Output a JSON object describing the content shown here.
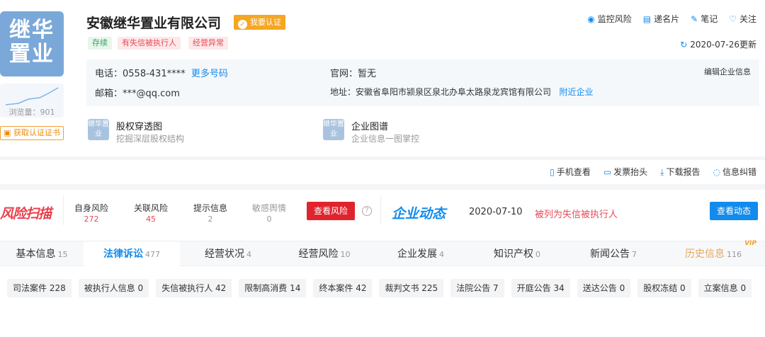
{
  "company": {
    "logo_text_line1": "继华",
    "logo_text_line2": "置业",
    "name": "安徽继华置业有限公司",
    "verify_label": "我要认证",
    "views": "浏览量：901",
    "cert_button": "获取认证证书",
    "tags": [
      "存续",
      "有失信被执行人",
      "经营异常"
    ]
  },
  "actions": [
    "监控风险",
    "递名片",
    "笔记",
    "关注"
  ],
  "update": "2020-07-26更新",
  "info": {
    "phone_label": "电话：",
    "phone": "0558-431****",
    "more_phones": "更多号码",
    "website_label": "官网：",
    "website": "暂无",
    "edit_link": "编辑企业信息",
    "email_label": "邮箱：",
    "email": "***@qq.com",
    "address_label": "地址：",
    "address": "安徽省阜阳市颍泉区泉北办阜太路泉龙宾馆有限公司",
    "nearby": "附近企业"
  },
  "shortcuts": [
    {
      "icon": "继华置业",
      "title": "股权穿透图",
      "sub": "挖掘深层股权结构"
    },
    {
      "icon": "继华置业",
      "title": "企业图谱",
      "sub": "企业信息一图掌控"
    }
  ],
  "tools": [
    "手机查看",
    "发票抬头",
    "下载报告",
    "信息纠错"
  ],
  "risk": {
    "logo": "风险扫描",
    "items": [
      {
        "label": "自身风险",
        "count": "272"
      },
      {
        "label": "关联风险",
        "count": "45"
      },
      {
        "label": "提示信息",
        "count": "2"
      },
      {
        "label": "敏感舆情",
        "count": "0"
      }
    ],
    "button": "查看风险"
  },
  "dynamics": {
    "logo": "企业动态",
    "date": "2020-07-10",
    "text": "被列为失信被执行人",
    "button": "查看动态"
  },
  "tabs": [
    {
      "label": "基本信息",
      "count": "15"
    },
    {
      "label": "法律诉讼",
      "count": "477"
    },
    {
      "label": "经营状况",
      "count": "4"
    },
    {
      "label": "经营风险",
      "count": "10"
    },
    {
      "label": "企业发展",
      "count": "4"
    },
    {
      "label": "知识产权",
      "count": "0"
    },
    {
      "label": "新闻公告",
      "count": "7"
    },
    {
      "label": "历史信息",
      "count": "116"
    }
  ],
  "vip": "VIP",
  "chips": [
    "司法案件 228",
    "被执行人信息 0",
    "失信被执行人 42",
    "限制高消费 14",
    "终本案件 42",
    "裁判文书 225",
    "法院公告 7",
    "开庭公告 34",
    "送达公告 0",
    "股权冻结 0",
    "立案信息 0"
  ],
  "colors": {
    "accent": "#128bed",
    "danger": "#e84a57",
    "warning": "#f5a623"
  }
}
